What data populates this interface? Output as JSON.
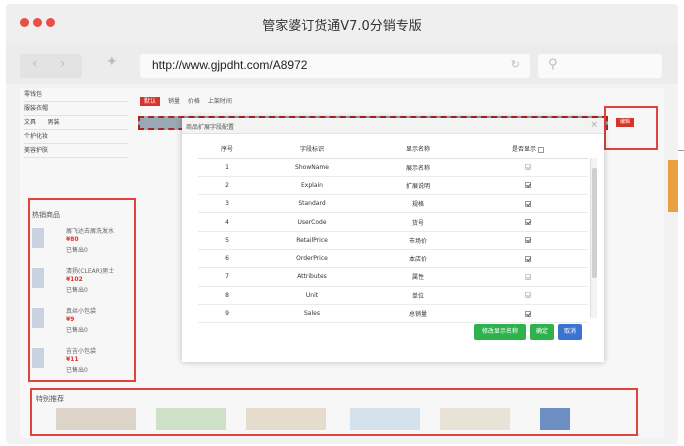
{
  "window": {
    "title": "管家婆订货通V7.0分销专版",
    "url": "http://www.gjpdht.com/A8972"
  },
  "left_nav": {
    "items": [
      "零钱包",
      "服装衣帽",
      "文具",
      "男装",
      "个护化妆",
      "美容护肤"
    ]
  },
  "category_bar": {
    "items": [
      "默认",
      "销量",
      "价格",
      "上架时间"
    ]
  },
  "edit_button": "编辑",
  "hot_products": {
    "title": "热销商品",
    "items": [
      {
        "name": "屑飞达去屑洗发水",
        "price": "¥80",
        "sold": "已售出0"
      },
      {
        "name": "清扬(CLEAR)男士",
        "price": "¥102",
        "sold": "已售出0"
      },
      {
        "name": "真丝小包袋",
        "price": "¥9",
        "sold": "已售出0"
      },
      {
        "name": "吉吉小包袋",
        "price": "¥11",
        "sold": "已售出0"
      }
    ]
  },
  "recommend": {
    "title": "特别推荐"
  },
  "dialog": {
    "title": "商品扩展字段配置",
    "close": "×",
    "columns": [
      "序号",
      "字段标识",
      "显示名称",
      "是否显示"
    ],
    "rows": [
      {
        "no": "1",
        "field": "ShowName",
        "display": "展示名称",
        "show": true,
        "enabled": false
      },
      {
        "no": "2",
        "field": "Explain",
        "display": "扩展说明",
        "show": true,
        "enabled": true
      },
      {
        "no": "3",
        "field": "Standard",
        "display": "规格",
        "show": true,
        "enabled": true
      },
      {
        "no": "4",
        "field": "UserCode",
        "display": "货号",
        "show": true,
        "enabled": true
      },
      {
        "no": "5",
        "field": "RetailPrice",
        "display": "市场价",
        "show": true,
        "enabled": true
      },
      {
        "no": "6",
        "field": "OrderPrice",
        "display": "本店价",
        "show": true,
        "enabled": true
      },
      {
        "no": "7",
        "field": "Attributes",
        "display": "属性",
        "show": true,
        "enabled": false
      },
      {
        "no": "8",
        "field": "Unit",
        "display": "单位",
        "show": true,
        "enabled": false
      },
      {
        "no": "9",
        "field": "Sales",
        "display": "总销量",
        "show": true,
        "enabled": true
      }
    ],
    "buttons": {
      "modify": "修改显示名称",
      "confirm": "确定",
      "cancel": "取消"
    }
  }
}
